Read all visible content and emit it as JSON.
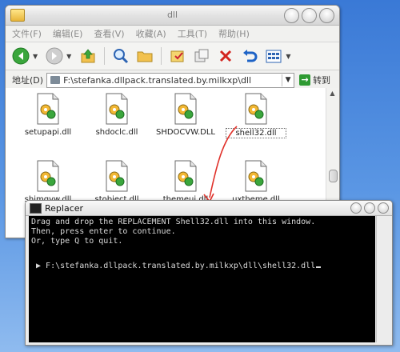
{
  "explorer": {
    "title": "dll",
    "menu": [
      "文件(F)",
      "编辑(E)",
      "查看(V)",
      "收藏(A)",
      "工具(T)",
      "帮助(H)"
    ],
    "address_label": "地址(D)",
    "address_value": "F:\\stefanka.dllpack.translated.by.milkxp\\dll",
    "go_label": "转到",
    "files": [
      {
        "name": "setupapi.dll"
      },
      {
        "name": "shdoclc.dll"
      },
      {
        "name": "SHDOCVW.DLL"
      },
      {
        "name": "shell32.dll",
        "selected": true
      },
      {
        "name": "shimgvw.dll"
      },
      {
        "name": "stobject.dll"
      },
      {
        "name": "themeui.dll"
      },
      {
        "name": "uxtheme.dll"
      }
    ]
  },
  "console": {
    "title": "Replacer",
    "lines": [
      "Drag and drop the REPLACEMENT Shell32.dll into this window.",
      "Then, press enter to continue.",
      "Or, type Q to quit."
    ],
    "command": " ▶ F:\\stefanka.dllpack.translated.by.milkxp\\dll\\shell32.dll"
  },
  "colors": {
    "desktop": "#4a86dc",
    "drag_arrow": "#e0312a",
    "console_bg": "#000000"
  }
}
